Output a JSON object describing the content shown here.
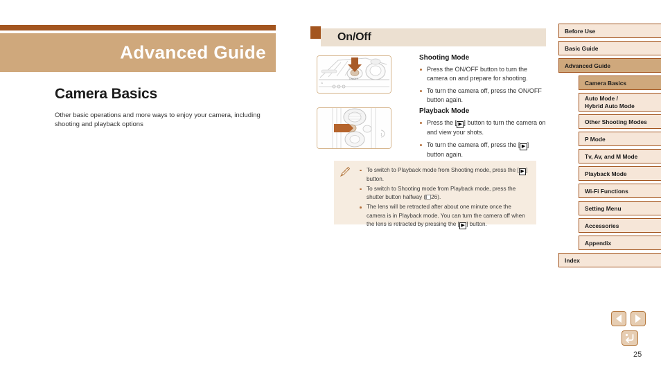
{
  "chapter": {
    "title": "Advanced Guide",
    "section_title": "Camera Basics",
    "section_desc": "Other basic operations and more ways to enjoy your camera, including shooting and playback options"
  },
  "topic": {
    "heading": "On/Off",
    "shooting": {
      "heading": "Shooting Mode",
      "bullets": [
        "Press the ON/OFF button to turn the camera on and prepare for shooting.",
        "To turn the camera off, press the ON/OFF button again."
      ]
    },
    "playback": {
      "heading": "Playback Mode",
      "bullets": [
        {
          "pre": "Press the [",
          "token": "▶",
          "post": "] button to turn the camera on and view your shots."
        },
        {
          "pre": "To turn the camera off, press the [",
          "token": "▶",
          "post": "] button again."
        }
      ]
    },
    "notes": [
      {
        "pre": "To switch to Playback mode from Shooting mode, press the [",
        "token": "▶",
        "post": "] button."
      },
      {
        "pre": "To switch to Shooting mode from Playback mode, press the shutter button halfway (",
        "booklet": true,
        "ref": "26",
        "post": ")."
      },
      {
        "pre": "The lens will be retracted after about one minute once the camera is in Playback mode. You can turn the camera off when the lens is retracted by pressing the [",
        "token": "▶",
        "post": "] button."
      }
    ]
  },
  "sidebar": {
    "items": [
      {
        "label": "Before Use",
        "level": "top",
        "active": false
      },
      {
        "label": "Basic Guide",
        "level": "top",
        "active": false
      },
      {
        "label": "Advanced Guide",
        "level": "top",
        "active": true
      },
      {
        "label": "Camera Basics",
        "level": "sub",
        "active": true
      },
      {
        "label": "Auto Mode /",
        "label2": "Hybrid Auto Mode",
        "level": "sub",
        "active": false
      },
      {
        "label": "Other Shooting Modes",
        "level": "sub",
        "active": false
      },
      {
        "label": "P Mode",
        "level": "sub",
        "active": false
      },
      {
        "label": "Tv, Av, and M Mode",
        "level": "sub",
        "active": false
      },
      {
        "label": "Playback Mode",
        "level": "sub",
        "active": false
      },
      {
        "label": "Wi-Fi Functions",
        "level": "sub",
        "active": false
      },
      {
        "label": "Setting Menu",
        "level": "sub",
        "active": false
      },
      {
        "label": "Accessories",
        "level": "sub",
        "active": false
      },
      {
        "label": "Appendix",
        "level": "sub",
        "active": false
      },
      {
        "label": "Index",
        "level": "top",
        "active": false
      }
    ]
  },
  "footer": {
    "prev_label": "Previous page",
    "next_label": "Next page",
    "home_label": "Return",
    "page_number": "25"
  },
  "colors": {
    "accent_dark": "#a3551f",
    "accent_tan": "#cfa87c",
    "accent_light": "#f6e6d8",
    "header_beige": "#ece0d1",
    "note_bg": "#f6ece0"
  }
}
